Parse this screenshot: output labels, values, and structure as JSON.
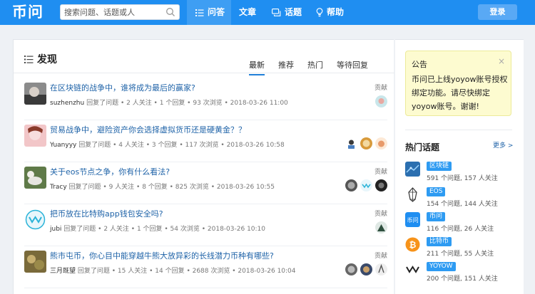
{
  "header": {
    "logo": "币问",
    "search_placeholder": "搜索问题、话题或人",
    "nav": [
      {
        "label": "问答",
        "icon": "list-icon"
      },
      {
        "label": "文章",
        "icon": ""
      },
      {
        "label": "话题",
        "icon": "chat-icon"
      },
      {
        "label": "帮助",
        "icon": "bulb-icon"
      }
    ],
    "login": "登录",
    "colors": {
      "brand": "#1f8ef1",
      "link": "#1f63a8"
    }
  },
  "discover": {
    "title": "发现",
    "tabs": [
      "最新",
      "推荐",
      "热门",
      "等待回复"
    ],
    "active_tab": "最新",
    "contrib_label": "贡献",
    "items": [
      {
        "title": "在区块链的战争中，谁将成为最后的赢家?",
        "user": "suzhenzhu",
        "meta": "回复了问题 • 2 人关注 • 1 个回复 • 93 次浏览 • 2018-03-26 11:00"
      },
      {
        "title": "贸易战争中，避险资产你会选择虚拟货币还是硬黄金？？",
        "user": "Yuanyyy",
        "meta": "回复了问题 • 4 人关注 • 3 个回复 • 117 次浏览 • 2018-03-26 10:58"
      },
      {
        "title": "关于eos节点之争，你有什么看法?",
        "user": "Tracy",
        "meta": "回复了问题 • 9 人关注 • 8 个回复 • 825 次浏览 • 2018-03-26 10:55"
      },
      {
        "title": "把币放在比特购app钱包安全吗?",
        "user": "jubi",
        "meta": "回复了问题 • 2 人关注 • 1 个回复 • 54 次浏览 • 2018-03-26 10:10"
      },
      {
        "title": "熊市屯币，你心目中能穿越牛熊大放异彩的长线潜力币种有哪些?",
        "user": "三月既望",
        "meta": "回复了问题 • 15 人关注 • 14 个回复 • 2688 次浏览 • 2018-03-26 10:04"
      }
    ]
  },
  "sidebar": {
    "notice_title": "公告",
    "notice_close": "×",
    "notice_text": "币问已上线yoyow账号授权绑定功能。请尽快绑定yoyow账号。谢谢!",
    "hot_title": "热门话题",
    "more": "更多 >",
    "topics": [
      {
        "tag": "区块链",
        "meta": "591 个问题, 157 人关注"
      },
      {
        "tag": "EOS",
        "meta": "154 个问题, 144 人关注"
      },
      {
        "tag": "币问",
        "meta": "116 个问题, 26 人关注"
      },
      {
        "tag": "比特币",
        "meta": "211 个问题, 55 人关注"
      },
      {
        "tag": "YOYOW",
        "meta": "200 个问题, 151 人关注"
      }
    ]
  }
}
